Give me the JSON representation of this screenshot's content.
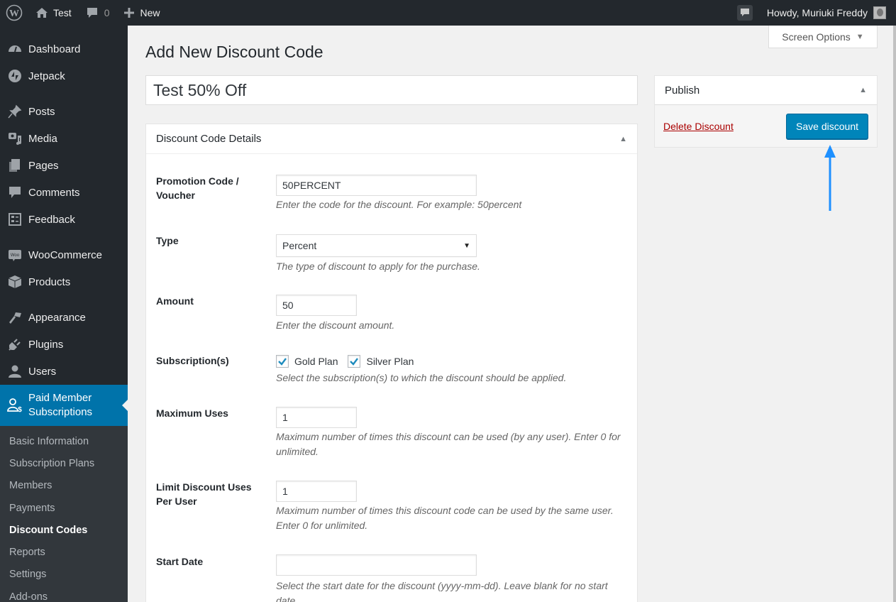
{
  "adminbar": {
    "site_name": "Test",
    "comments_count": "0",
    "new_label": "New",
    "greeting": "Howdy, Muriuki Freddy"
  },
  "sidebar": {
    "items": [
      {
        "label": "Dashboard",
        "icon": "dashboard-icon"
      },
      {
        "label": "Jetpack",
        "icon": "jetpack-icon"
      },
      {
        "label": "Posts",
        "icon": "pin-icon"
      },
      {
        "label": "Media",
        "icon": "media-icon"
      },
      {
        "label": "Pages",
        "icon": "pages-icon"
      },
      {
        "label": "Comments",
        "icon": "comment-icon"
      },
      {
        "label": "Feedback",
        "icon": "feedback-icon"
      },
      {
        "label": "WooCommerce",
        "icon": "woo-icon"
      },
      {
        "label": "Products",
        "icon": "box-icon"
      },
      {
        "label": "Appearance",
        "icon": "brush-icon"
      },
      {
        "label": "Plugins",
        "icon": "plug-icon"
      },
      {
        "label": "Users",
        "icon": "user-icon"
      },
      {
        "label_line1": "Paid Member",
        "label_line2": "Subscriptions",
        "icon": "member-dollar-icon"
      }
    ],
    "submenu": [
      {
        "label": "Basic Information"
      },
      {
        "label": "Subscription Plans"
      },
      {
        "label": "Members"
      },
      {
        "label": "Payments"
      },
      {
        "label": "Discount Codes",
        "current": true
      },
      {
        "label": "Reports"
      },
      {
        "label": "Settings"
      },
      {
        "label": "Add-ons"
      }
    ]
  },
  "screen_options": {
    "label": "Screen Options"
  },
  "page": {
    "title": "Add New Discount Code",
    "name_value": "Test 50% Off"
  },
  "details": {
    "heading": "Discount Code Details",
    "fields": {
      "code": {
        "label_line1": "Promotion Code /",
        "label_line2": "Voucher",
        "value": "50PERCENT",
        "desc": "Enter the code for the discount. For example: 50percent"
      },
      "type": {
        "label": "Type",
        "value": "Percent",
        "desc": "The type of discount to apply for the purchase."
      },
      "amount": {
        "label": "Amount",
        "value": "50",
        "desc": "Enter the discount amount."
      },
      "subscriptions": {
        "label": "Subscription(s)",
        "options": [
          {
            "label": "Gold Plan",
            "checked": true
          },
          {
            "label": "Silver Plan",
            "checked": true
          }
        ],
        "desc": "Select the subscription(s) to which the discount should be applied."
      },
      "max_uses": {
        "label": "Maximum Uses",
        "value": "1",
        "desc": "Maximum number of times this discount can be used (by any user). Enter 0 for unlimited."
      },
      "per_user": {
        "label_line1": "Limit Discount Uses",
        "label_line2": "Per User",
        "value": "1",
        "desc": "Maximum number of times this discount code can be used by the same user. Enter 0 for unlimited."
      },
      "start_date": {
        "label": "Start Date",
        "value": "",
        "desc": "Select the start date for the discount (yyyy-mm-dd). Leave blank for no start date."
      }
    }
  },
  "publish": {
    "heading": "Publish",
    "delete_label": "Delete Discount",
    "save_label": "Save discount"
  },
  "colors": {
    "accent": "#0073aa",
    "button": "#0085ba",
    "delete": "#aa0000",
    "annotation_arrow": "#1e90ff"
  }
}
